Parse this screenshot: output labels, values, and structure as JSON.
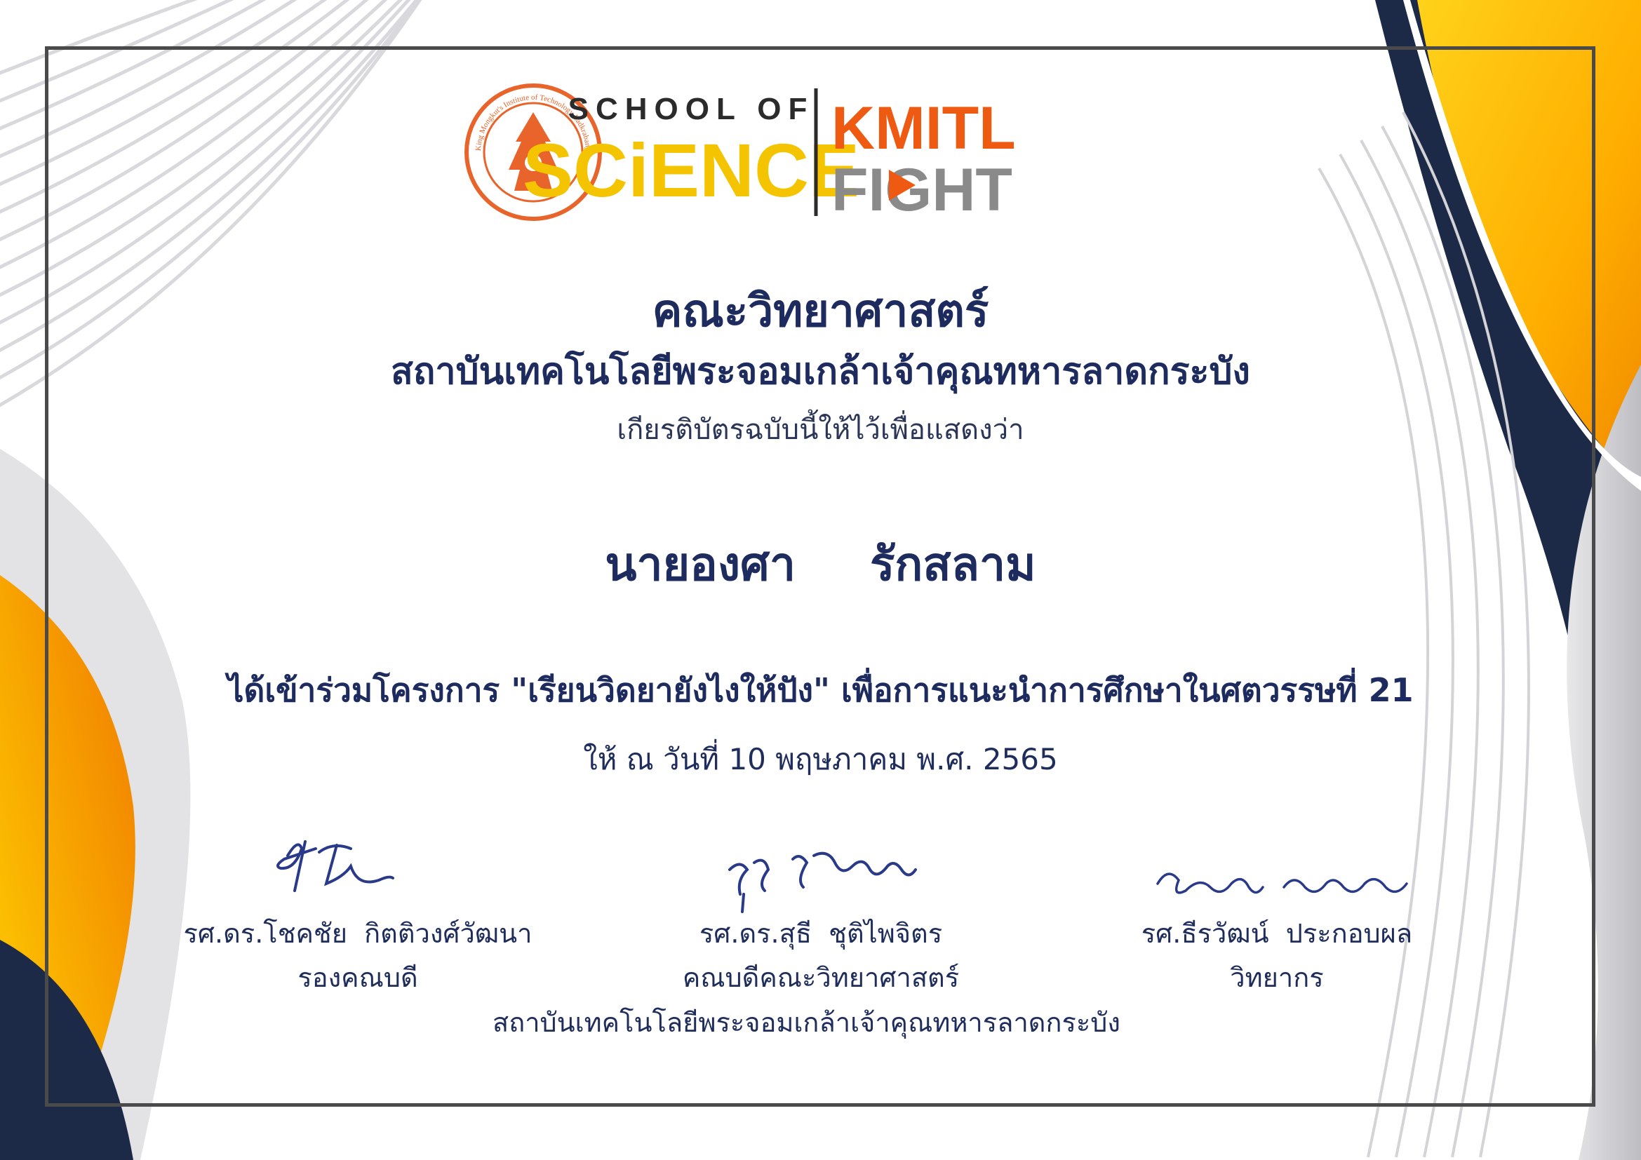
{
  "logos": {
    "seal_text": "King Mongkut's Institute of Technology Ladkrabang",
    "school_of": "SCHOOL OF",
    "science": "SCiENCE",
    "kmitl": "KMITL",
    "fight": "FIGHT"
  },
  "header": {
    "faculty": "คณะวิทยาศาสตร์",
    "institute": "สถาบันเทคโนโลยีพระจอมเกล้าเจ้าคุณทหารลาดกระบัง",
    "intro": "เกียรติบัตรฉบับนี้ให้ไว้เพื่อแสดงว่า"
  },
  "recipient": {
    "name": "นายองศา  รักสลาม"
  },
  "body": {
    "project": "ได้เข้าร่วมโครงการ \"เรียนวิดยายังไงให้ปัง\" เพื่อการแนะนำการศึกษาในศตวรรษที่ 21",
    "date": "ให้ ณ วันที่ 10 พฤษภาคม พ.ศ. 2565"
  },
  "signatories": [
    {
      "name": "รศ.ดร.โชคชัย  กิตติวงศ์วัฒนา",
      "role": "รองคณบดี"
    },
    {
      "name": "รศ.ดร.สุธี  ชุติไพจิตร",
      "role": "คณบดีคณะวิทยาศาสตร์"
    },
    {
      "name": "รศ.ธีรวัฒน์  ประกอบผล",
      "role": "วิทยากร"
    }
  ],
  "footer": {
    "institute": "สถาบันเทคโนโลยีพระจอมเกล้าเจ้าคุณทหารลาดกระบัง"
  },
  "colors": {
    "navy": "#1d2b5e",
    "orange": "#f39200",
    "yellow": "#ffc400",
    "science_yellow": "#f5c400",
    "kmitl_orange": "#ef5a12",
    "fight_gray": "#8a8a8a",
    "seal_orange": "#e8642a",
    "signature_ink": "#2a3a8a"
  }
}
